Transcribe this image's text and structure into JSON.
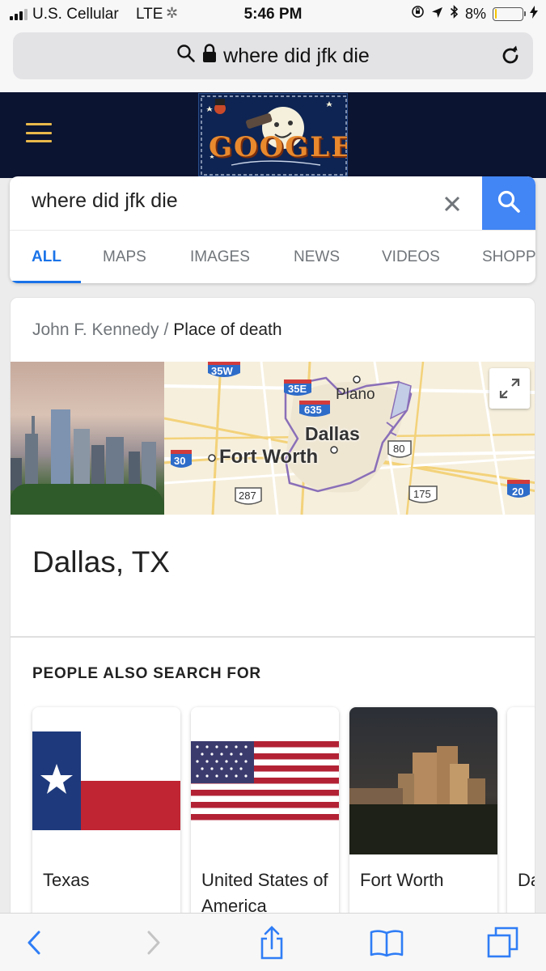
{
  "status_bar": {
    "carrier": "U.S. Cellular",
    "network": "LTE",
    "time": "5:46 PM",
    "battery": "8%",
    "battery_level": 0.08,
    "battery_color": "#f5c400"
  },
  "browser": {
    "url": "where did jfk die",
    "icons": [
      "search-icon",
      "lock-icon",
      "reload-icon"
    ]
  },
  "google": {
    "doodle_text": "GOOGLE",
    "header_color": "#0b1431",
    "search_query": "where did jfk die",
    "accent_color": "#4285f4",
    "tabs": [
      {
        "label": "ALL",
        "active": true
      },
      {
        "label": "MAPS"
      },
      {
        "label": "IMAGES"
      },
      {
        "label": "NEWS"
      },
      {
        "label": "VIDEOS"
      },
      {
        "label": "SHOPP"
      }
    ]
  },
  "result": {
    "breadcrumb_parent": "John F. Kennedy",
    "breadcrumb_separator": "/",
    "breadcrumb_current": "Place of death",
    "title": "Dallas, TX",
    "map_labels": {
      "city_main": "Dallas",
      "city_fort_worth": "Fort Worth",
      "city_plano": "Plano",
      "shields": [
        "35W",
        "35E",
        "635",
        "30",
        "80",
        "287",
        "175",
        "20"
      ]
    }
  },
  "people_also_search": {
    "title": "PEOPLE ALSO SEARCH FOR",
    "items": [
      {
        "label": "Texas"
      },
      {
        "label": "United States of America"
      },
      {
        "label": "Fort Worth"
      },
      {
        "label": "Dall Texa"
      }
    ]
  },
  "toolbar": {
    "icons": [
      "back-icon",
      "forward-icon",
      "share-icon",
      "bookmarks-icon",
      "tabs-icon"
    ]
  }
}
